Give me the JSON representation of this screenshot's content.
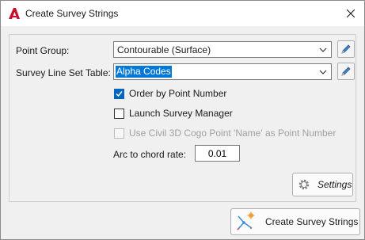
{
  "window": {
    "title": "Create Survey Strings",
    "app_icon": "autocad-a-icon",
    "close_icon": "close-icon"
  },
  "form": {
    "point_group_label": "Point Group:",
    "point_group_value": "Contourable (Surface)",
    "survey_line_label": "Survey Line Set Table:",
    "survey_line_value": "Alpha Codes",
    "order_by_point_number": {
      "label": "Order by Point Number",
      "checked": true
    },
    "launch_survey_manager": {
      "label": "Launch Survey Manager",
      "checked": false
    },
    "use_cogo_name": {
      "label": "Use Civil 3D Cogo Point 'Name' as Point Number",
      "checked": false,
      "disabled": true
    },
    "arc_label": "Arc to chord rate:",
    "arc_value": "0.01"
  },
  "buttons": {
    "settings_label": "Settings",
    "create_label": "Create Survey Strings"
  },
  "colors": {
    "accent": "#0078d7",
    "checkbox_checked": "#0067c0",
    "app_icon_red": "#c8102e"
  }
}
